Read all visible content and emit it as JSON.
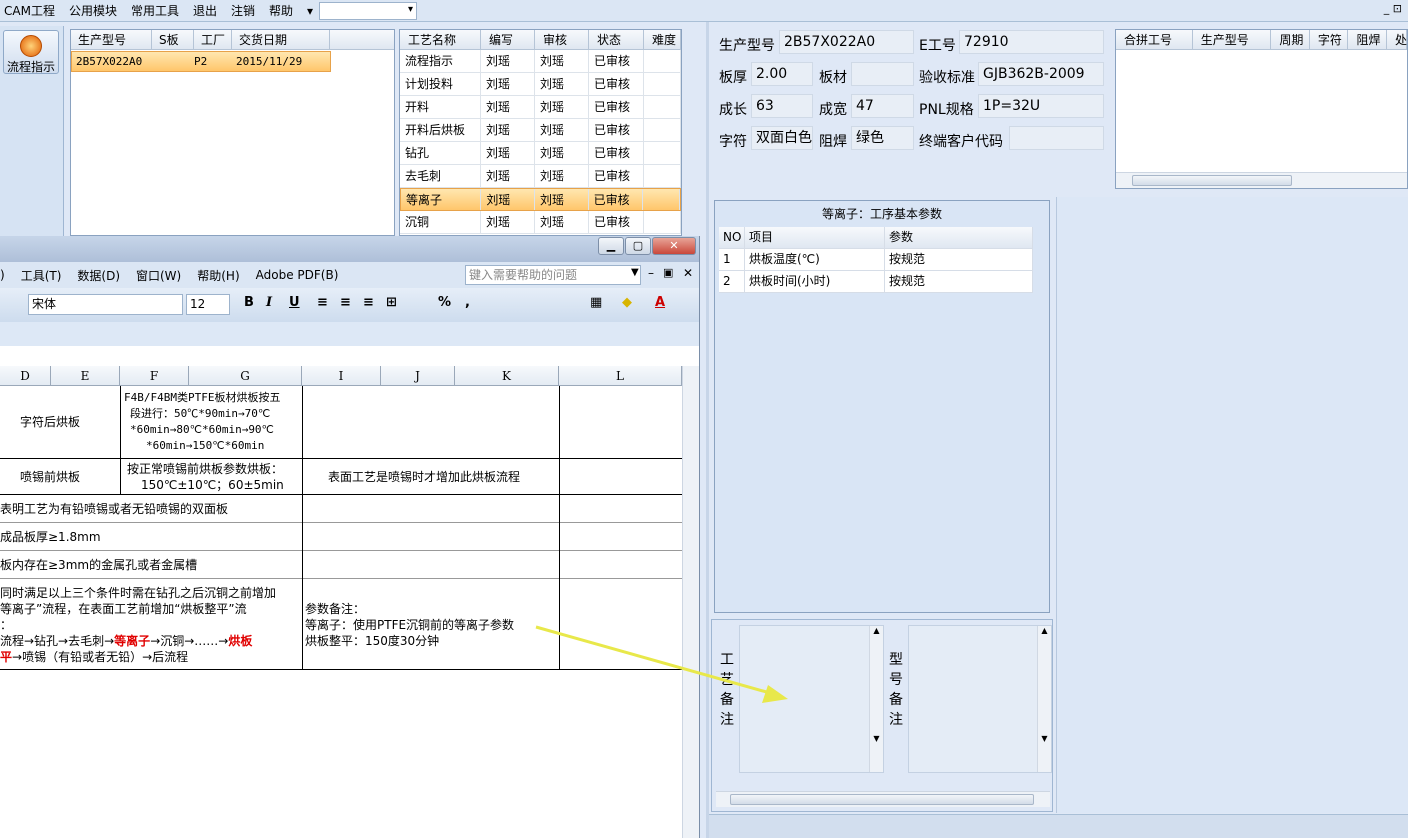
{
  "menu": {
    "items": [
      "CAM工程",
      "公用模块",
      "常用工具",
      "退出",
      "注销",
      "帮助"
    ],
    "right": "_ ⊡"
  },
  "left_button": {
    "label": "流程指示"
  },
  "orders": {
    "headers": [
      "生产型号",
      "S板",
      "工厂",
      "交货日期"
    ],
    "rows": [
      [
        "2B57X022A0",
        "",
        "P2",
        "2015/11/29"
      ]
    ]
  },
  "process": {
    "headers": [
      "工艺名称",
      "编写",
      "审核",
      "状态",
      "难度"
    ],
    "rows": [
      [
        "流程指示",
        "刘瑶",
        "刘瑶",
        "已审核",
        ""
      ],
      [
        "计划投料",
        "刘瑶",
        "刘瑶",
        "已审核",
        ""
      ],
      [
        "开料",
        "刘瑶",
        "刘瑶",
        "已审核",
        ""
      ],
      [
        "开料后烘板",
        "刘瑶",
        "刘瑶",
        "已审核",
        ""
      ],
      [
        "钻孔",
        "刘瑶",
        "刘瑶",
        "已审核",
        ""
      ],
      [
        "去毛刺",
        "刘瑶",
        "刘瑶",
        "已审核",
        ""
      ],
      [
        "等离子",
        "刘瑶",
        "刘瑶",
        "已审核",
        ""
      ],
      [
        "沉铜",
        "刘瑶",
        "刘瑶",
        "已审核",
        ""
      ]
    ],
    "selected": 6
  },
  "info": {
    "model_label": "生产型号",
    "model": "2B57X022A0",
    "eno_label": "E工号",
    "eno": "72910",
    "thick_label": "板厚",
    "thick": "2.00",
    "material_label": "板材",
    "material": "",
    "std_label": "验收标准",
    "std": "GJB362B-2009",
    "len_label": "成长",
    "len": "63",
    "wid_label": "成宽",
    "wid": "47",
    "pnl_label": "PNL规格",
    "pnl": "1P=32U",
    "char_label": "字符",
    "char": "双面白色",
    "mask_label": "阻焊",
    "mask": "绿色",
    "cust_label": "终端客户代码",
    "cust": ""
  },
  "combine": {
    "headers": [
      "合拼工号",
      "生产型号",
      "周期",
      "字符",
      "阻焊",
      "处"
    ]
  },
  "param": {
    "title": "等离子：工序基本参数",
    "headers": [
      "NO",
      "项目",
      "参数"
    ],
    "rows": [
      [
        "1",
        "烘板温度(℃)",
        "按规范"
      ],
      [
        "2",
        "烘板时间(小时)",
        "按规范"
      ]
    ]
  },
  "notes": {
    "process_label": [
      "工",
      "艺",
      "备",
      "注"
    ],
    "model_label": [
      "型",
      "号",
      "备",
      "注"
    ]
  },
  "excel": {
    "menu": [
      ")",
      "工具(T)",
      "数据(D)",
      "窗口(W)",
      "帮助(H)",
      "Adobe PDF(B)"
    ],
    "help_placeholder": "键入需要帮助的问题",
    "font": "宋体",
    "size": "12",
    "cols": [
      "D",
      "E",
      "F",
      "G",
      "I",
      "J",
      "K",
      "L"
    ],
    "r1_name": "字符后烘板",
    "r1_text": [
      "F4B/F4BM类PTFE板材烘板按五",
      "段进行：50℃*90min→70℃",
      "*60min→80℃*60min→90℃",
      "*60min→150℃*60min"
    ],
    "r2_name": "喷锡前烘板",
    "r2_text": [
      "按正常喷锡前烘板参数烘板：",
      "150℃±10℃；60±5min"
    ],
    "r2_note": "表面工艺是喷锡时才增加此烘板流程",
    "r3": "表明工艺为有铅喷锡或者无铅喷锡的双面板",
    "r4": "成品板厚≥1.8mm",
    "r5": "板内存在≥3mm的金属孔或者金属槽",
    "r6_l1": "同时满足以上三个条件时需在钻孔之后沉铜之前增加",
    "r6_l2": "等离子”流程，在表面工艺前增加“烘板整平”流",
    "r6_l3": "：",
    "r6_l4a": "流程→钻孔→去毛刺→",
    "r6_l4b": "等离子",
    "r6_l4c": "→沉铜→……→",
    "r6_l4d": "烘板",
    "r6_l5a": "平",
    "r6_l5b": "→喷锡（有铅或者无铅）→后流程",
    "r6_note": [
      "参数备注：",
      "等离子：使用PTFE沉铜前的等离子参数",
      "烘板整平：150度30分钟"
    ]
  },
  "colors": {
    "selection": "#ffc66b",
    "arrow": "#e8e84a"
  }
}
